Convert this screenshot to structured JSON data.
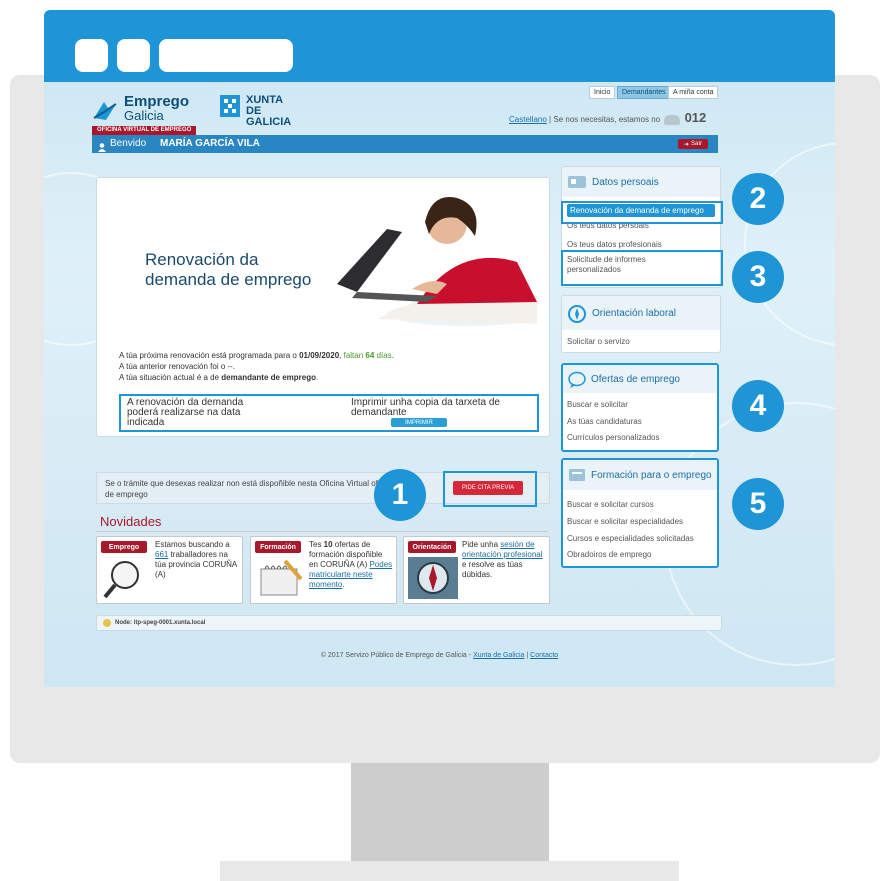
{
  "header_site": {
    "logo_word1": "Emprego",
    "logo_word2": "Galicia",
    "xunta_line1": "XUNTA",
    "xunta_line2": "DE GALICIA",
    "nav": [
      "Inicio",
      "Demandantes",
      "A miña conta"
    ],
    "language": "Castellano",
    "help_text": "Se nos necesitas, estamos no",
    "phone": "012",
    "office_label": "OFICINA VIRTUAL DE EMPREGO"
  },
  "userbar": {
    "welcome": "Benvido",
    "user_name": "MARÍA GARCÍA VILA",
    "logout": "Saír"
  },
  "main": {
    "hero_title": "Renovación da demanda de emprego",
    "line1_prefix": "A túa próxima renovación está programada para o ",
    "line1_date": "01/09/2020",
    "line1_sep": ", ",
    "line1_faltan": "faltan",
    "line1_days": "64",
    "line1_dias": "días",
    "line1_end": ".",
    "line2": "A túa anterior renovación foi o --.",
    "line3_prefix": "A túa situación actual é a de ",
    "line3_bold": "demandante de emprego",
    "line3_end": ".",
    "box_left": "A renovación da demanda poderá realizarse na data indicada",
    "box_right": "Imprimir unha copia da tarxeta de demandante",
    "print_button": "IMPRIMIR",
    "notice_text": "Se o trámite que desexas realizar non está dispoñible nesta Oficina Virtual oficina de emprego",
    "cita_button": "PIDE CITA PREVIA"
  },
  "novidades": {
    "title": "Novidades",
    "cards": [
      {
        "tag": "Emprego",
        "p1": "Estamos buscando a ",
        "link1": "661",
        "p2": " traballadores na túa provincia CORUÑA (A)",
        "tag_color": "#a8182a"
      },
      {
        "tag": "Formación",
        "p1": "Tes ",
        "bold": "10",
        "p2": " ofertas de formación dispoñible en CORUÑA (A) ",
        "link1": "Podes matricularte neste momento",
        "p3": ".",
        "tag_color": "#a8182a"
      },
      {
        "tag": "Orientación",
        "p1": "Pide unha ",
        "link1": "sesión de orientación profesional",
        "p2": " e resolve as túas dúbidas.",
        "tag_color": "#a8182a"
      }
    ]
  },
  "node_text": "Node: itp-speg-0001.xunta.local",
  "footer": {
    "copyright": "© 2017 Servizo Público de Emprego de Galicia - ",
    "xunta_link": "Xunta de Galicia",
    "sep": " | ",
    "contact_link": "Contacto"
  },
  "sidebar": {
    "datos": {
      "title": "Datos persoais",
      "items": [
        "Renovación da demanda de emprego",
        "Os teus datos persoais",
        "Os teus datos profesionais",
        "Solicitude de informes personalizados"
      ]
    },
    "orientacion": {
      "title": "Orientación laboral",
      "items": [
        "Solicitar o servizo"
      ]
    },
    "ofertas": {
      "title": "Ofertas de emprego",
      "items": [
        "Buscar e solicitar",
        "As túas candidaturas",
        "Currículos personalizados"
      ]
    },
    "formacion": {
      "title": "Formación para o emprego",
      "items": [
        "Buscar e solicitar cursos",
        "Buscar e solicitar especialidades",
        "Cursos e especialidades solicitadas",
        "Obradoiros de emprego"
      ]
    }
  },
  "markers": [
    "1",
    "2",
    "3",
    "4",
    "5"
  ],
  "colors": {
    "accent_blue": "#1d95d6",
    "brand_red": "#d6283b",
    "userbar_blue": "#2a85c3",
    "highlight_green": "#4a9a2c"
  }
}
